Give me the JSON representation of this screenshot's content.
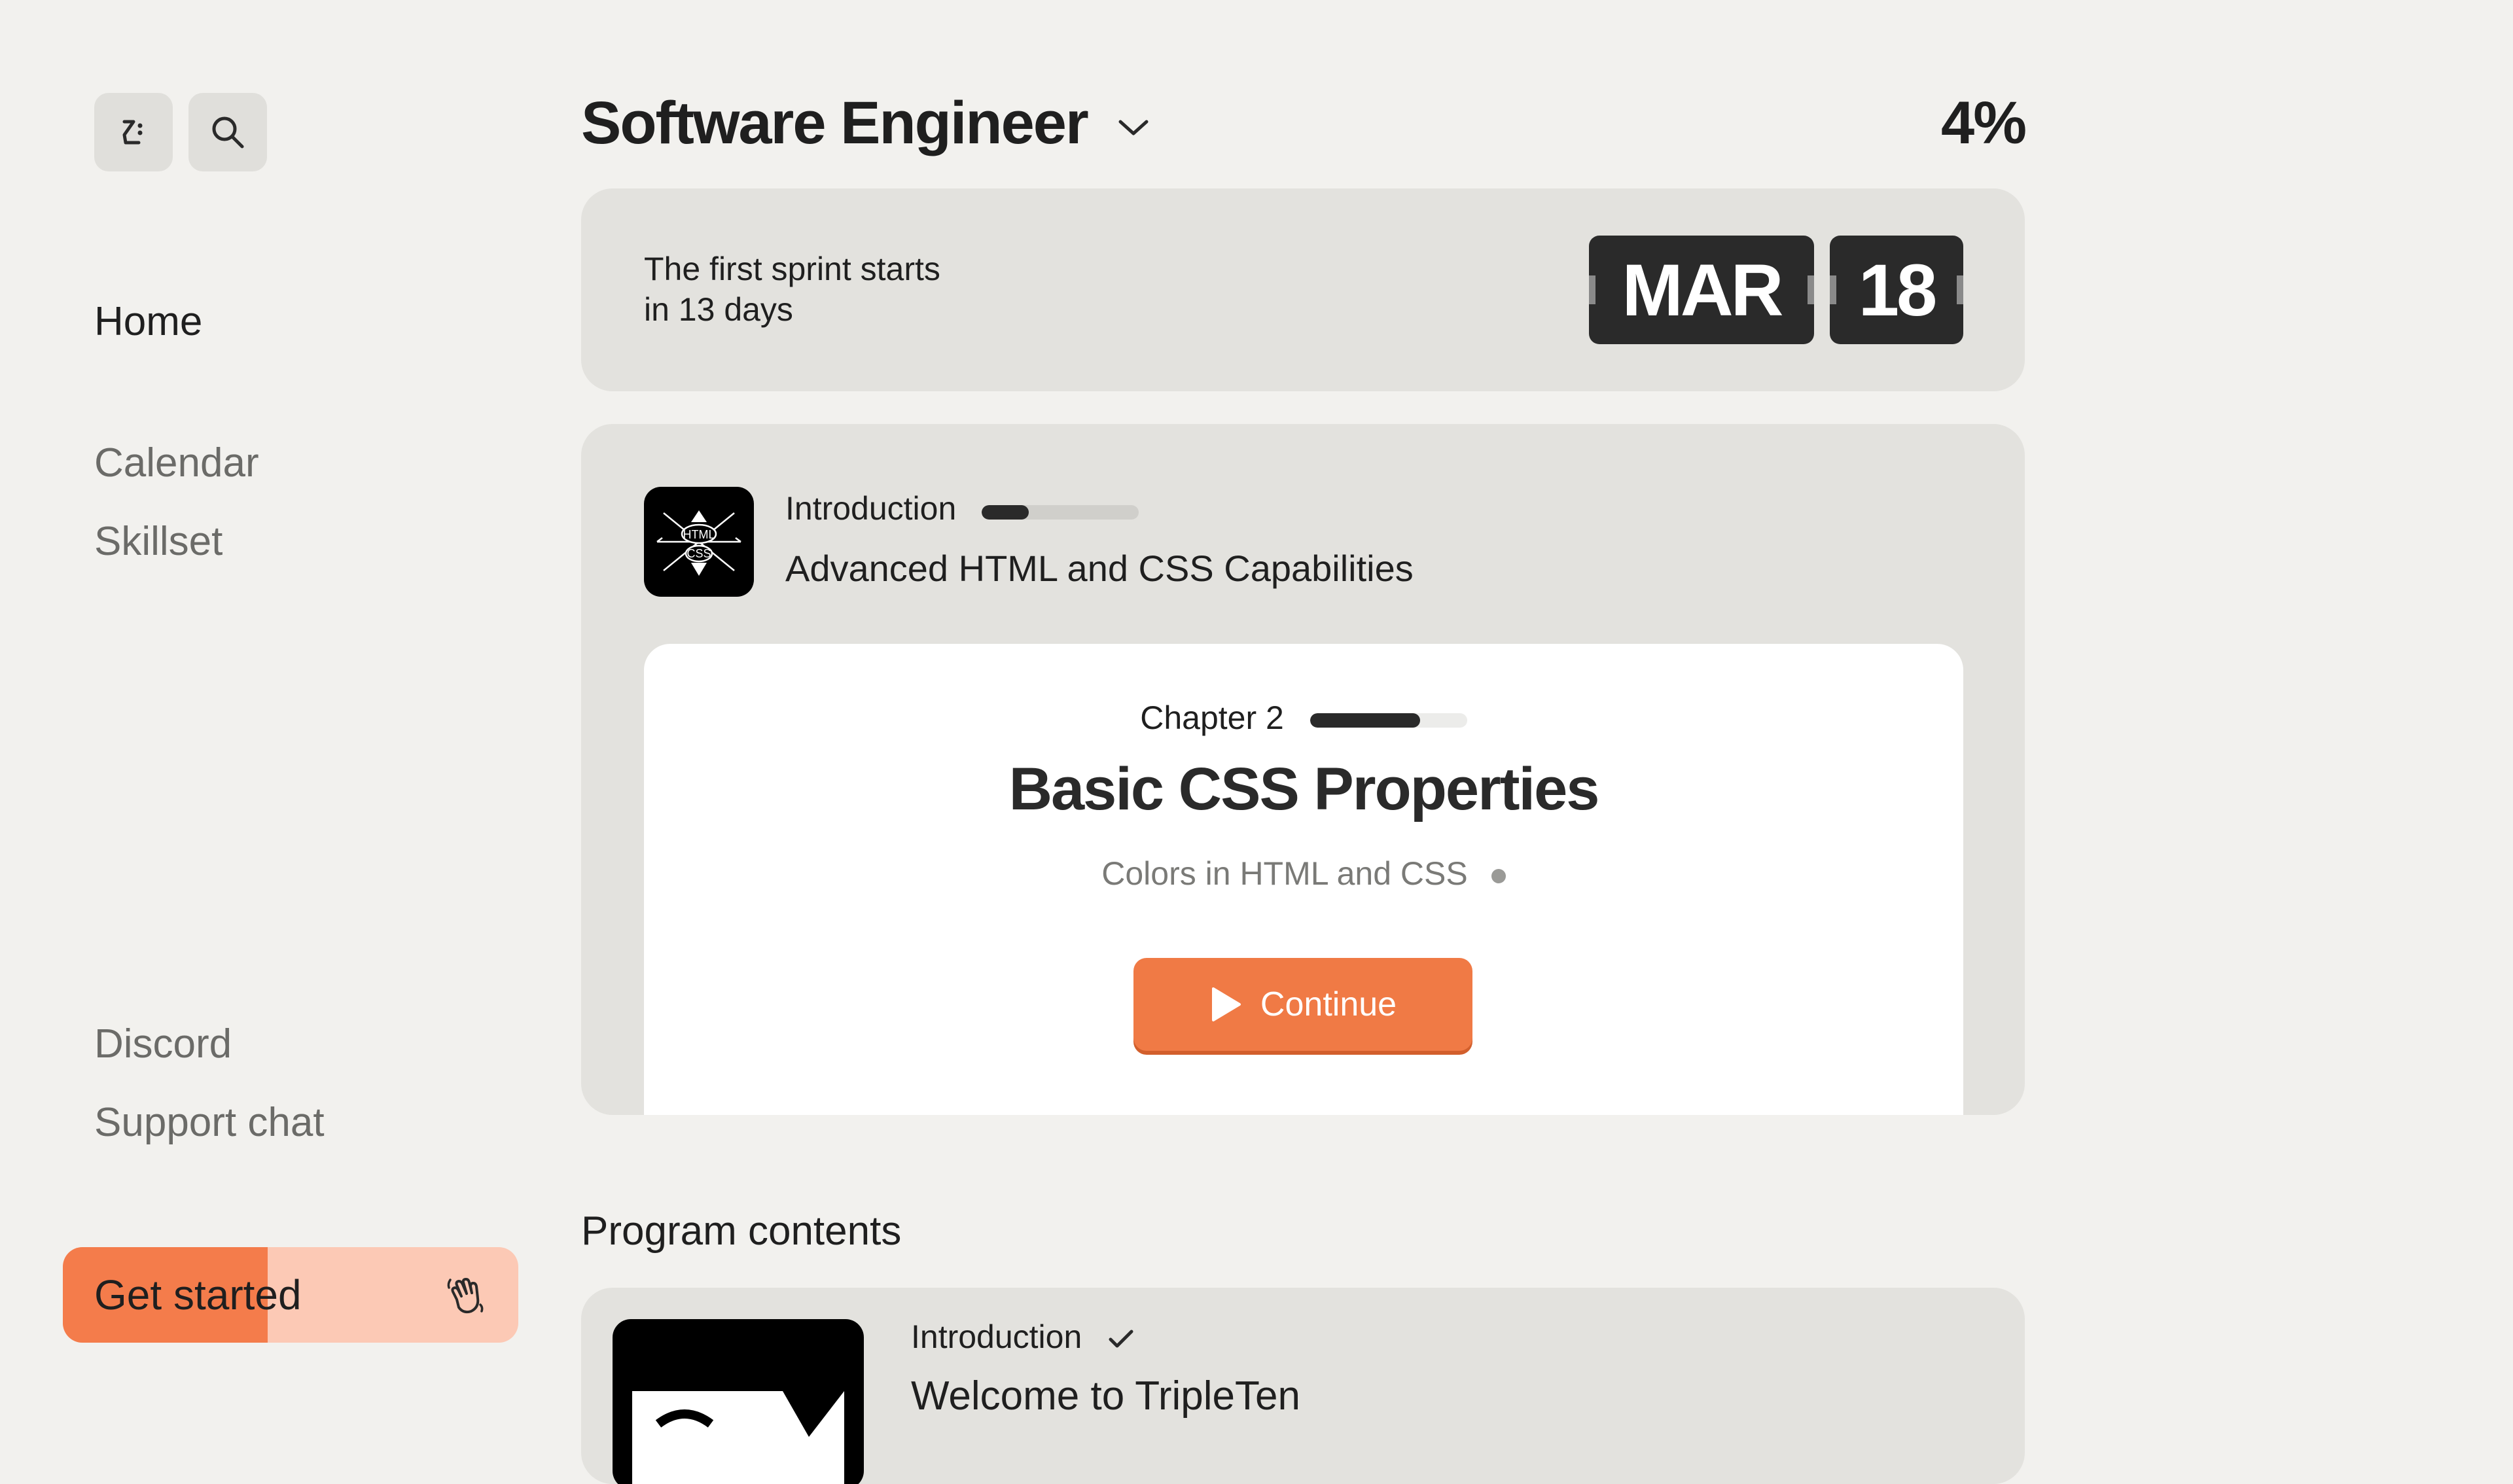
{
  "sidebar": {
    "logo_icon": "tripleten-logo-icon",
    "search_icon": "search-icon",
    "items": [
      {
        "label": "Home",
        "active": true
      },
      {
        "label": "Calendar"
      },
      {
        "label": "Skillset"
      }
    ],
    "bottom_items": [
      {
        "label": "Discord"
      },
      {
        "label": "Support chat"
      }
    ],
    "get_started": {
      "label": "Get started",
      "icon": "waving-hand-icon",
      "progress": 0.45
    }
  },
  "header": {
    "program": "Software Engineer",
    "progress_percent": "4%"
  },
  "sprint": {
    "text_line1": "The first sprint starts",
    "text_line2": "in 13 days",
    "month": "MAR",
    "day": "18"
  },
  "course": {
    "section_label": "Introduction",
    "section_progress": 0.3,
    "title": "Advanced HTML and CSS Capabilities",
    "icon_text_top": "HTML",
    "icon_text_bottom": "CSS",
    "chapter_label": "Chapter 2",
    "chapter_progress": 0.7,
    "chapter_title": "Basic CSS Properties",
    "lesson": "Colors in HTML and CSS",
    "continue_label": "Continue",
    "accent": "#f07a45"
  },
  "program_contents": {
    "title": "Program contents",
    "items": [
      {
        "section": "Introduction",
        "completed": true,
        "title": "Welcome to TripleTen"
      }
    ]
  }
}
